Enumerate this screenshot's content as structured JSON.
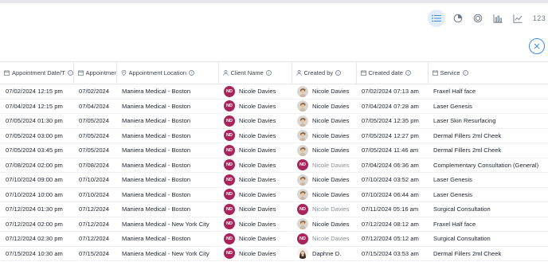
{
  "toolbar": {
    "buttons": [
      {
        "name": "list-view",
        "icon": "list-icon",
        "active": true
      },
      {
        "name": "pie-view",
        "icon": "pie-chart-icon",
        "active": false
      },
      {
        "name": "donut-view",
        "icon": "donut-chart-icon",
        "active": false
      },
      {
        "name": "bar-view",
        "icon": "bar-chart-icon",
        "active": false
      },
      {
        "name": "line-view",
        "icon": "line-chart-icon",
        "active": false
      }
    ],
    "number_label": "123"
  },
  "columns": [
    {
      "label": "Appointment Date/Time",
      "icon": "calendar-icon",
      "info": true
    },
    {
      "label": "Appointment d",
      "icon": "calendar-icon",
      "info": false
    },
    {
      "label": "Appointment Location",
      "icon": "location-icon",
      "info": true
    },
    {
      "label": "Client Name",
      "icon": "person-icon",
      "info": true
    },
    {
      "label": "Created by",
      "icon": "person-icon",
      "info": true
    },
    {
      "label": "Created date",
      "icon": "calendar-icon",
      "info": true
    },
    {
      "label": "Service",
      "icon": "calendar-icon",
      "info": true
    }
  ],
  "rows": [
    {
      "datetime": "07/02/2024 12:15 pm",
      "date": "07/02/2024",
      "location": "Maniera Medical - Boston",
      "client_initials": "ND",
      "client": "Nicole Davies",
      "creator_avatar": "photo",
      "creator": "Nicole Davies",
      "creator_muted": false,
      "created": "07/02/2024 07:13 am",
      "service": "Fraxel Half face"
    },
    {
      "datetime": "07/04/2024 12:15 pm",
      "date": "07/04/2024",
      "location": "Maniera Medical - Boston",
      "client_initials": "ND",
      "client": "Nicole Davies",
      "creator_avatar": "photo",
      "creator": "Nicole Davies",
      "creator_muted": false,
      "created": "07/04/2024 07:28 am",
      "service": "Laser Genesis"
    },
    {
      "datetime": "07/05/2024 01:30 pm",
      "date": "07/05/2024",
      "location": "Maniera Medical - Boston",
      "client_initials": "ND",
      "client": "Nicole Davies",
      "creator_avatar": "photo",
      "creator": "Nicole Davies",
      "creator_muted": false,
      "created": "07/05/2024 12:35 pm",
      "service": "Laser Skin Resurfacing"
    },
    {
      "datetime": "07/05/2024 03:00 pm",
      "date": "07/05/2024",
      "location": "Maniera Medical - Boston",
      "client_initials": "ND",
      "client": "Nicole Davies",
      "creator_avatar": "photo",
      "creator": "Nicole Davies",
      "creator_muted": false,
      "created": "07/05/2024 12:27 pm",
      "service": "Dermal Fillers 2ml Cheek"
    },
    {
      "datetime": "07/05/2024 03:45 pm",
      "date": "07/05/2024",
      "location": "Maniera Medical - Boston",
      "client_initials": "ND",
      "client": "Nicole Davies",
      "creator_avatar": "photo",
      "creator": "Nicole Davies",
      "creator_muted": false,
      "created": "07/05/2024 11:46 am",
      "service": "Dermal Fillers 2ml Cheek"
    },
    {
      "datetime": "07/08/2024 02:00 pm",
      "date": "07/08/2024",
      "location": "Maniera Medical - Boston",
      "client_initials": "ND",
      "client": "Nicole Davies",
      "creator_avatar": "initials",
      "creator_initials": "ND",
      "creator": "Nicole Davies",
      "creator_muted": true,
      "created": "07/04/2024 06:36 am",
      "service": "Complementary Consultation (General)"
    },
    {
      "datetime": "07/10/2024 09:00 am",
      "date": "07/10/2024",
      "location": "Maniera Medical - Boston",
      "client_initials": "ND",
      "client": "Nicole Davies",
      "creator_avatar": "photo",
      "creator": "Nicole Davies",
      "creator_muted": false,
      "created": "07/10/2024 03:52 am",
      "service": "Laser Genesis"
    },
    {
      "datetime": "07/10/2024 10:00 am",
      "date": "07/10/2024",
      "location": "Maniera Medical - Boston",
      "client_initials": "ND",
      "client": "Nicole Davies",
      "creator_avatar": "photo",
      "creator": "Nicole Davies",
      "creator_muted": false,
      "created": "07/10/2024 06:44 am",
      "service": "Laser Genesis"
    },
    {
      "datetime": "07/12/2024 01:30 pm",
      "date": "07/12/2024",
      "location": "Maniera Medical - Boston",
      "client_initials": "ND",
      "client": "Nicole Davies",
      "creator_avatar": "initials",
      "creator_initials": "ND",
      "creator": "Nicole Davies",
      "creator_muted": true,
      "created": "07/11/2024 05:16 am",
      "service": "Surgical Consultation"
    },
    {
      "datetime": "07/12/2024 02:00 pm",
      "date": "07/12/2024",
      "location": "Maniera Medical - New York City",
      "client_initials": "ND",
      "client": "Nicole Davies",
      "creator_avatar": "photo",
      "creator": "Nicole Davies",
      "creator_muted": false,
      "created": "07/12/2024 08:12 am",
      "service": "Fraxel Half face"
    },
    {
      "datetime": "07/12/2024 02:30 pm",
      "date": "07/12/2024",
      "location": "Maniera Medical - Boston",
      "client_initials": "ND",
      "client": "Nicole Davies",
      "creator_avatar": "initials",
      "creator_initials": "ND",
      "creator": "Nicole Davies",
      "creator_muted": true,
      "created": "07/12/2024 05:12 am",
      "service": "Surgical Consultation"
    },
    {
      "datetime": "07/15/2024 10:30 am",
      "date": "07/15/2024",
      "location": "Maniera Medical - New York City",
      "client_initials": "ND",
      "client": "Nicole Davies",
      "creator_avatar": "photo2",
      "creator": "Daphne D.",
      "creator_muted": false,
      "created": "07/15/2024 03:53 am",
      "service": "Dermal Fillers 2ml Cheek"
    }
  ],
  "colors": {
    "accent": "#3a8fe0",
    "badge": "#a8245a",
    "active_bg": "#e3edf9"
  }
}
